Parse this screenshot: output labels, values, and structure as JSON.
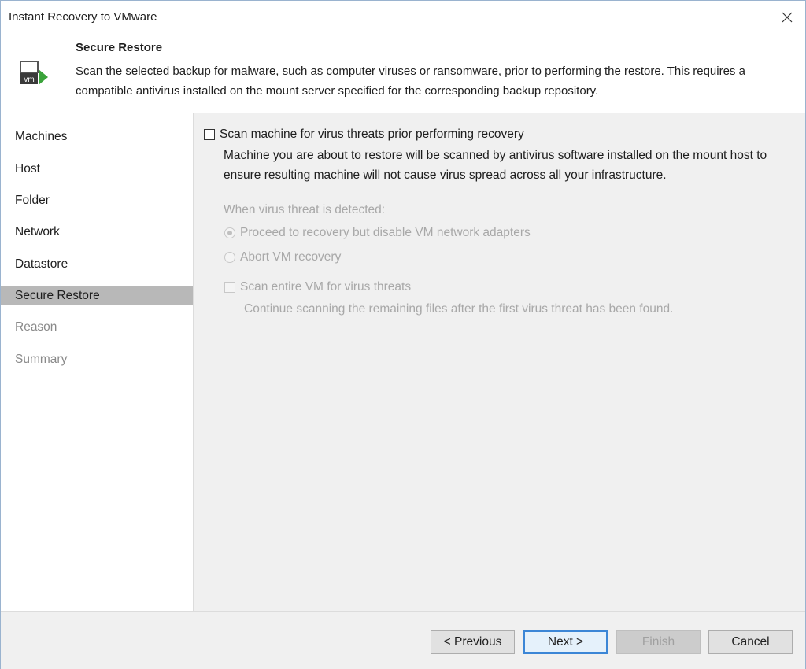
{
  "window": {
    "title": "Instant Recovery to VMware"
  },
  "header": {
    "title": "Secure Restore",
    "description": "Scan the selected backup for malware, such as computer viruses or ransomware, prior to performing the restore. This requires a compatible antivirus installed on the mount server specified for the corresponding backup repository.",
    "icon": "vm-arrow-icon"
  },
  "sidebar": {
    "items": [
      {
        "label": "Machines",
        "state": "normal"
      },
      {
        "label": "Host",
        "state": "normal"
      },
      {
        "label": "Folder",
        "state": "normal"
      },
      {
        "label": "Network",
        "state": "normal"
      },
      {
        "label": "Datastore",
        "state": "normal"
      },
      {
        "label": "Secure Restore",
        "state": "active"
      },
      {
        "label": "Reason",
        "state": "disabled"
      },
      {
        "label": "Summary",
        "state": "disabled"
      }
    ]
  },
  "content": {
    "scan_checkbox": {
      "label": "Scan machine for virus threats prior performing recovery",
      "checked": false,
      "description_line1": "Machine you are about to restore will be scanned by antivirus software installed on the mount host to",
      "description_line2": "ensure resulting machine will not cause virus spread across all your infrastructure."
    },
    "threat_group_label": "When virus threat is detected:",
    "radio_proceed": {
      "label": "Proceed to recovery but disable VM network adapters",
      "selected": true,
      "enabled": false
    },
    "radio_abort": {
      "label": "Abort VM recovery",
      "selected": false,
      "enabled": false
    },
    "scan_entire": {
      "label": "Scan entire VM for virus threats",
      "checked": false,
      "enabled": false,
      "description": "Continue scanning the remaining files after the first virus threat has been found."
    }
  },
  "footer": {
    "previous": "< Previous",
    "next": "Next >",
    "finish": "Finish",
    "cancel": "Cancel"
  },
  "colors": {
    "active_nav_bg": "#b8b8b8",
    "default_button_border": "#3c86d6",
    "disabled_text": "#a8a8a8"
  }
}
